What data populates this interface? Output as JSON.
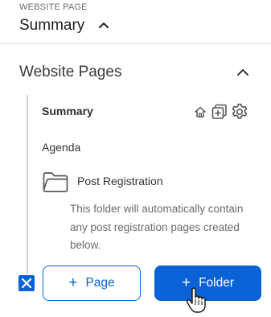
{
  "header": {
    "label": "WEBSITE PAGE",
    "title": "Summary",
    "chevron_icon": "chevron-up-icon"
  },
  "section": {
    "title": "Website Pages",
    "chevron_icon": "chevron-up-icon"
  },
  "pages": [
    {
      "label": "Summary",
      "active": true
    },
    {
      "label": "Agenda",
      "active": false
    }
  ],
  "item_actions": [
    "home-icon",
    "add-page-icon",
    "gear-icon"
  ],
  "folder": {
    "icon": "folder-icon",
    "name": "Post Registration",
    "description": "This folder will automatically contain any post registration pages created below."
  },
  "actions": {
    "cancel_icon": "close-icon",
    "page_button": {
      "icon": "+",
      "label": "Page"
    },
    "folder_button": {
      "icon": "+",
      "label": "Folder"
    }
  },
  "colors": {
    "accent": "#0b62d6",
    "text": "#2b2b2b",
    "muted": "#6b6b6b",
    "divider": "#e1e1e1"
  }
}
